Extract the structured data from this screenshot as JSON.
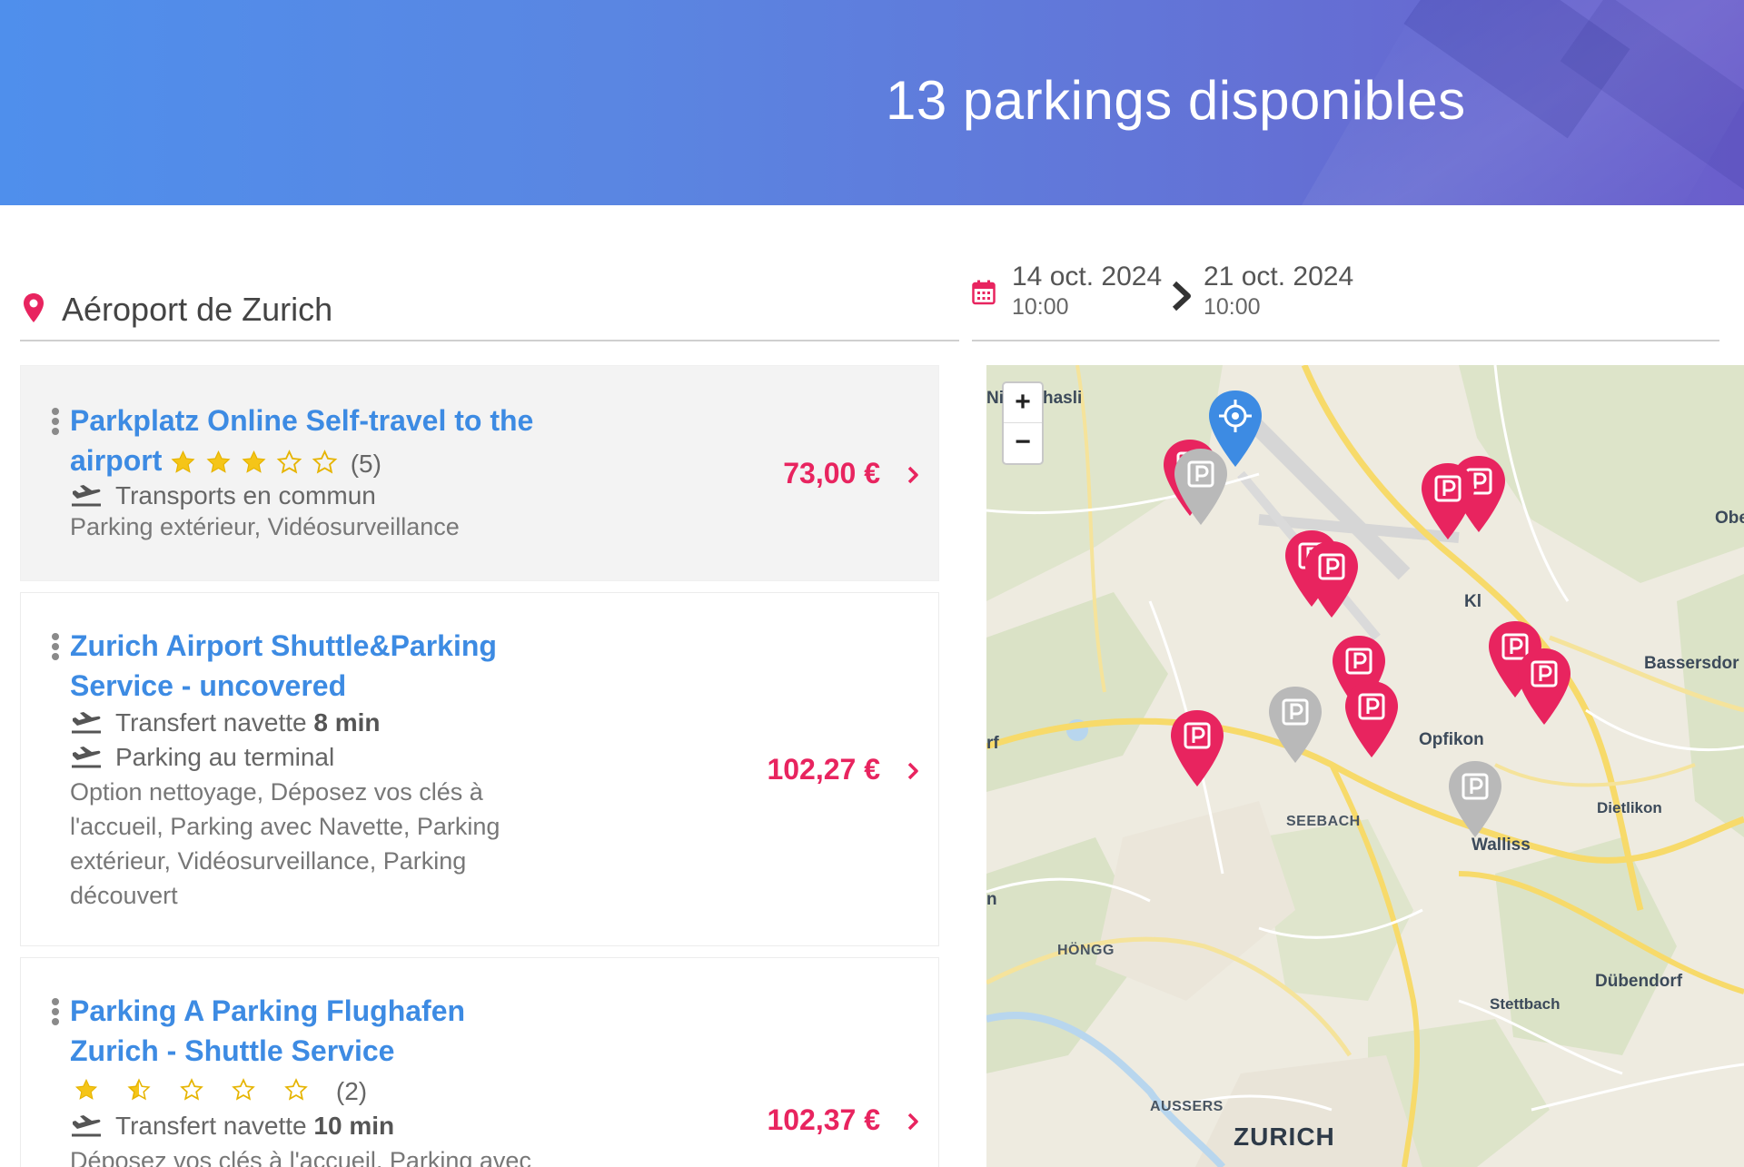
{
  "header": {
    "title": "13 parkings disponibles"
  },
  "search": {
    "location": "Aéroport de Zurich",
    "from_date": "14 oct. 2024",
    "from_time": "10:00",
    "to_date": "21 oct. 2024",
    "to_time": "10:00"
  },
  "listings": [
    {
      "title": "Parkplatz Online Self-travel to the airport",
      "rating": 3,
      "rating_count": "(5)",
      "features": [
        "Transports en commun"
      ],
      "description": "Parking extérieur, Vidéosurveillance",
      "price": "73,00 €"
    },
    {
      "title": "Zurich Airport Shuttle&Parking Service - uncovered",
      "features_prefix": [
        "Transfert navette",
        "Parking au terminal"
      ],
      "features_bold": [
        "8 min",
        ""
      ],
      "description": "Option nettoyage, Déposez vos clés à l'accueil, Parking avec Navette, Parking extérieur, Vidéosurveillance, Parking découvert",
      "price": "102,27 €"
    },
    {
      "title": "Parking A Parking Flughafen Zurich - Shuttle Service",
      "rating": 1.5,
      "rating_count": "(2)",
      "features_prefix": [
        "Transfert navette"
      ],
      "features_bold": [
        "10 min"
      ],
      "description": "Déposez vos clés à l'accueil, Parking avec",
      "price": "102,37 €"
    }
  ],
  "map": {
    "zoom_in": "+",
    "zoom_out": "−",
    "places": [
      "Ni",
      "hasli",
      "Obe",
      "Kl",
      "Bassersdor",
      "rf",
      "Opfikon",
      "Dietlikon",
      "SEEBACH",
      "Walliss",
      "n",
      "HÖNGG",
      "Dübendorf",
      "Stettbach",
      "AUSSERS",
      "ZURICH"
    ],
    "colors": {
      "available": "#e8245f",
      "unavailable": "#b9b9b9",
      "user": "#3d8be3"
    }
  }
}
